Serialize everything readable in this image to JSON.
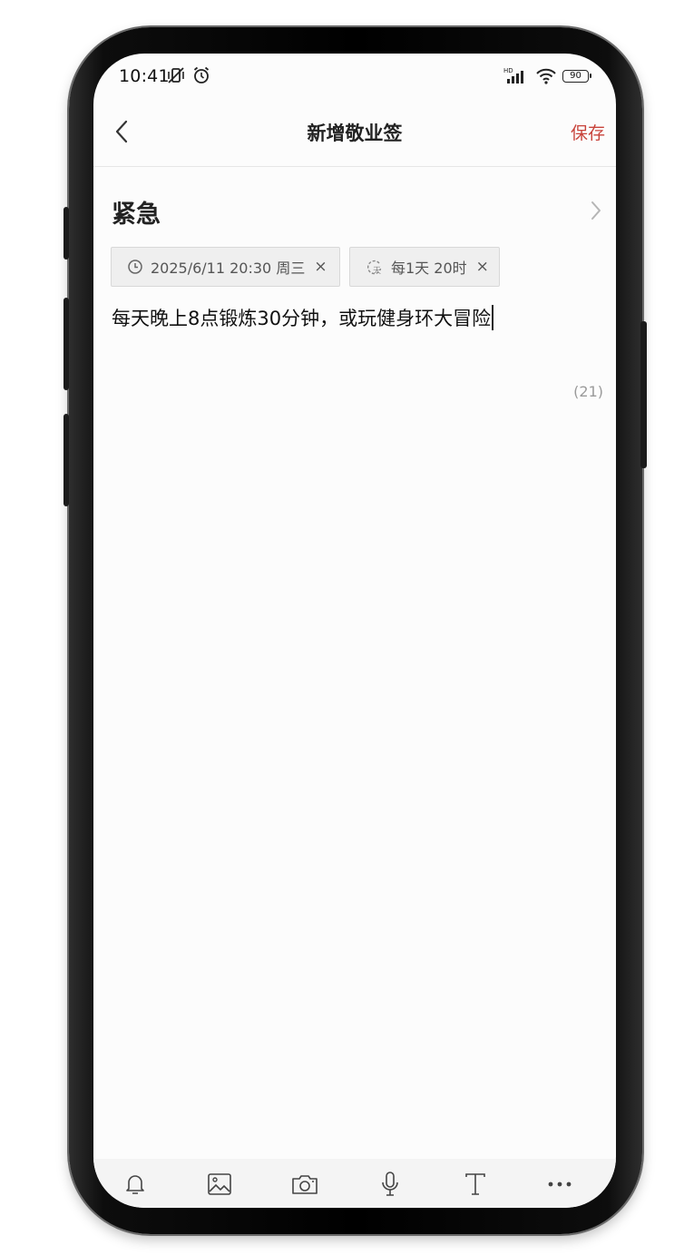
{
  "status_bar": {
    "time": "10:41",
    "network_label": "HD",
    "battery": "90",
    "icons": [
      "vibrate-off-icon",
      "alarm-icon",
      "signal-icon",
      "wifi-icon",
      "battery-icon"
    ]
  },
  "header": {
    "title": "新增敬业签",
    "save_label": "保存"
  },
  "category": {
    "label": "紧急"
  },
  "chips": {
    "reminder": {
      "text": "2025/6/11 20:30 周三",
      "close": "×",
      "icon": "clock-icon"
    },
    "repeat": {
      "text": "每1天 20时",
      "close": "×",
      "icon": "repeat-icon",
      "icon_text": "天"
    }
  },
  "note": {
    "text": "每天晚上8点锻炼30分钟，或玩健身环大冒险",
    "char_count": "(21)"
  },
  "toolbar": {
    "items": [
      "bell-icon",
      "image-icon",
      "camera-icon",
      "microphone-icon",
      "text-format-icon",
      "more-icon"
    ]
  },
  "colors": {
    "accent": "#c8433b",
    "screen_bg": "#fcfcfc",
    "chip_bg": "#efefef"
  }
}
